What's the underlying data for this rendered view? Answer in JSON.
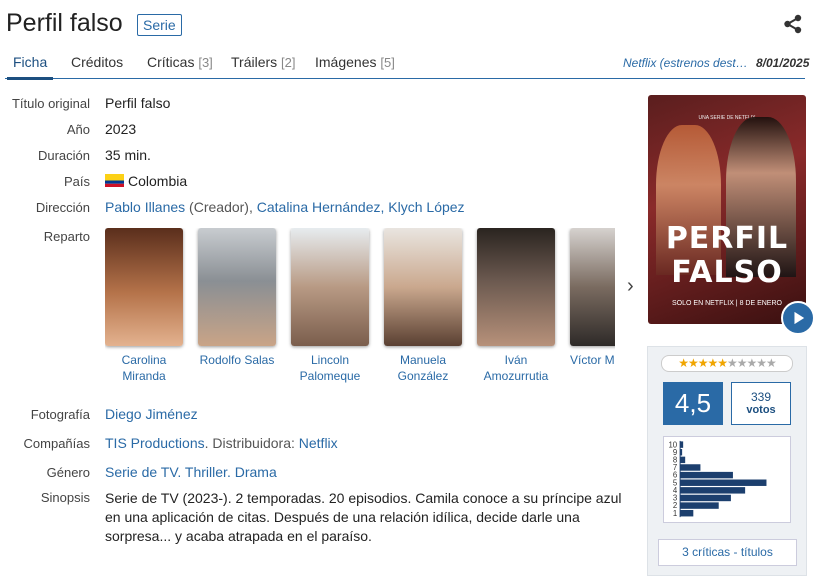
{
  "header": {
    "title": "Perfil falso",
    "badge": "Serie"
  },
  "tabs": [
    {
      "label": "Ficha",
      "count": ""
    },
    {
      "label": "Créditos",
      "count": ""
    },
    {
      "label": "Críticas",
      "count": "[3]"
    },
    {
      "label": "Tráilers",
      "count": "[2]"
    },
    {
      "label": "Imágenes",
      "count": "[5]"
    }
  ],
  "release": {
    "platform": "Netflix (estrenos dest…",
    "date": "8/01/2025"
  },
  "info": {
    "original_title_label": "Título original",
    "original_title": "Perfil falso",
    "year_label": "Año",
    "year": "2023",
    "duration_label": "Duración",
    "duration": "35 min.",
    "country_label": "País",
    "country": "Colombia",
    "direction_label": "Dirección",
    "director1": "Pablo Illanes",
    "director1_role": " (Creador), ",
    "director2": "Catalina Hernández",
    "director_sep": ", ",
    "director3": "Klych López",
    "cast_label": "Reparto",
    "photo_label": "Fotografía",
    "photo": "Diego Jiménez",
    "companies_label": "Compañías",
    "company": "TIS Productions",
    "company_sep": ". Distribuidora: ",
    "distributor": "Netflix",
    "genre_label": "Género",
    "genre1": "Serie de TV",
    "genre2": "Thriller",
    "genre3": "Drama",
    "genre_sep": ". ",
    "synopsis_label": "Sinopsis",
    "synopsis": "Serie de TV (2023-). 2 temporadas. 20 episodios. Camila conoce a su príncipe azul en una aplicación de citas. Después de una relación idílica, decide darle una sorpresa... y acaba atrapada en el paraíso."
  },
  "cast": [
    {
      "name": "Carolina Miranda",
      "bg": "#b5734a"
    },
    {
      "name": "Rodolfo Salas",
      "bg": "#8a8f94"
    },
    {
      "name": "Lincoln Palomeque",
      "bg": "#b89a84"
    },
    {
      "name": "Manuela González",
      "bg": "#caa88e"
    },
    {
      "name": "Iván Amozurrutia",
      "bg": "#6c5a50"
    },
    {
      "name": "Víctor M",
      "bg": "#7a6b60"
    }
  ],
  "poster": {
    "tagline": "UNA SERIE DE NETFLIX",
    "title_line1": "PERFIL",
    "title_line2": "FALSO",
    "footer": "SOLO EN NETFLIX | 8 DE ENERO"
  },
  "rating": {
    "stars_filled": 4.5,
    "stars_total": 10,
    "average": "4,5",
    "votes": "339",
    "votes_label": "votos",
    "histogram_labels": [
      "10",
      "9",
      "8",
      "7",
      "6",
      "5",
      "4",
      "3",
      "2",
      "1"
    ],
    "histogram_fractions": [
      0.03,
      0.02,
      0.05,
      0.2,
      0.52,
      0.85,
      0.64,
      0.5,
      0.38,
      0.13
    ],
    "criticas_link": "3 críticas - títulos"
  },
  "colors": {
    "link": "#2a6aa6",
    "accent": "#1c4f80",
    "star": "#f0a500"
  }
}
